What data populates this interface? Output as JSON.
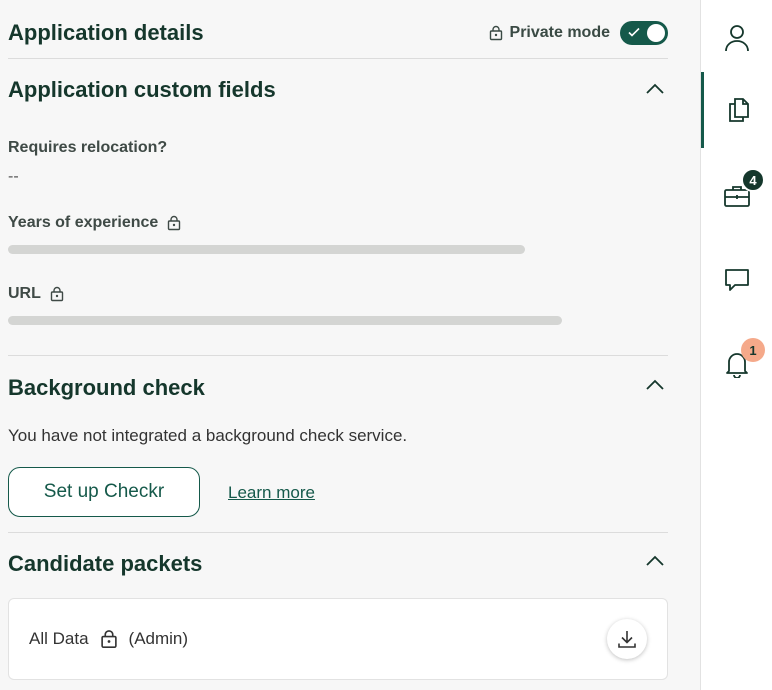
{
  "header": {
    "title": "Application details",
    "private_mode_label": "Private mode",
    "private_mode_on": true
  },
  "custom_fields": {
    "title": "Application custom fields",
    "fields": [
      {
        "label": "Requires relocation?",
        "value": "--"
      },
      {
        "label": "Years of experience",
        "locked": true
      },
      {
        "label": "URL",
        "locked": true
      }
    ]
  },
  "background_check": {
    "title": "Background check",
    "message": "You have not integrated a background check service.",
    "setup_button": "Set up Checkr",
    "learn_more": "Learn more"
  },
  "candidate_packets": {
    "title": "Candidate packets",
    "item_name": "All Data",
    "item_role": "(Admin)"
  },
  "sidebar": {
    "items": [
      {
        "icon": "person-icon"
      },
      {
        "icon": "documents-icon",
        "active": true
      },
      {
        "icon": "briefcase-icon",
        "badge": "4"
      },
      {
        "icon": "chat-icon"
      },
      {
        "icon": "bell-icon",
        "badge": "1"
      }
    ]
  },
  "colors": {
    "accent": "#15594a",
    "badge_dark": "#15372c",
    "badge_alert": "#f5a98a"
  }
}
